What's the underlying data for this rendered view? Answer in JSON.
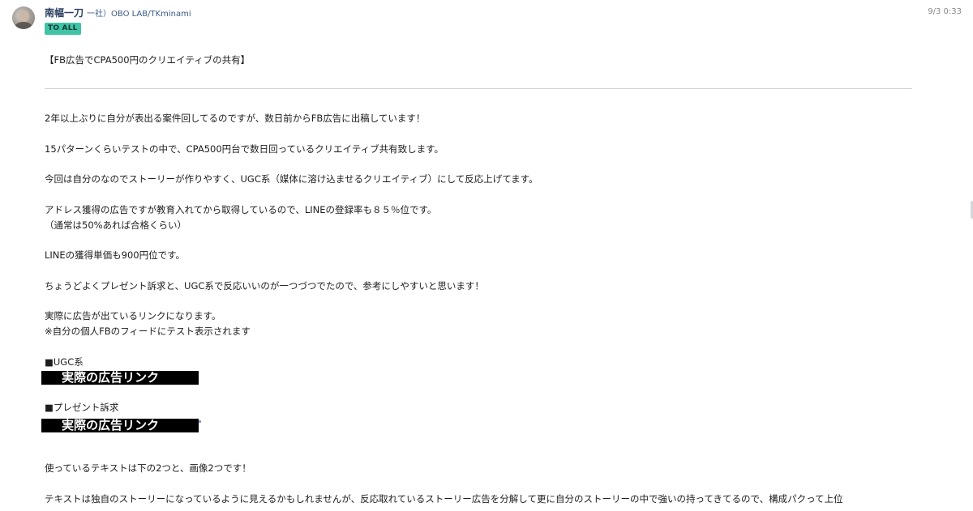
{
  "message": {
    "sender_name": "南幅一刀",
    "sender_org": "一社）OBO LAB/TKminami",
    "timestamp": "9/3 0:33",
    "to_badge": "TO ALL",
    "title": "【FB広告でCPA500円のクリエイティブの共有】",
    "lines": {
      "l1": "2年以上ぶりに自分が表出る案件回してるのですが、数日前からFB広告に出稿しています！",
      "l2": "15パターンくらいテストの中で、CPA500円台で数日回っているクリエイティブ共有致します。",
      "l3": "今回は自分のなのでストーリーが作りやすく、UGC系（媒体に溶け込ませるクリエイティブ）にして反応上げてます。",
      "l4": "アドレス獲得の広告ですが教育入れてから取得しているので、LINEの登録率も８５％位です。",
      "l5": "（通常は50%あれば合格くらい）",
      "l6": "LINEの獲得単価も900円位です。",
      "l7": "ちょうどよくプレゼント訴求と、UGC系で反応いいのが一つづつでたので、参考にしやすいと思います！",
      "l8": "実際に広告が出ているリンクになります。",
      "l9": "※自分の個人FBのフィードにテスト表示されます",
      "l10": "■UGC系",
      "l11": "■プレゼント訴求",
      "l12": "使っているテキストは下の2つと、画像2つです！",
      "l13": "テキストは独自のストーリーになっているように見えるかもしれませんが、反応取れているストーリー広告を分解して更に自分のストーリーの中で強いの持ってきてるので、構成パクって上位"
    },
    "links": {
      "ugc_link": "実際の広告リンク",
      "present_link": "実際の広告リンク"
    }
  }
}
